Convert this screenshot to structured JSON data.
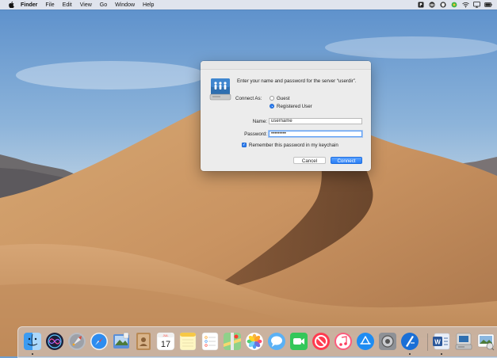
{
  "menubar": {
    "apple_icon": "apple-icon",
    "items": [
      {
        "label": "Finder",
        "name": "menu-finder"
      },
      {
        "label": "File",
        "name": "menu-file"
      },
      {
        "label": "Edit",
        "name": "menu-edit"
      },
      {
        "label": "View",
        "name": "menu-view"
      },
      {
        "label": "Go",
        "name": "menu-go"
      },
      {
        "label": "Window",
        "name": "menu-window"
      },
      {
        "label": "Help",
        "name": "menu-help"
      }
    ],
    "status_icons": [
      "parking-icon",
      "creative-cloud-icon",
      "shield-icon",
      "green-dot-icon",
      "wifi-icon",
      "airplay-icon",
      "battery-icon"
    ]
  },
  "dialog": {
    "prompt": "Enter your name and password for the server “userdir”.",
    "connect_as_label": "Connect As:",
    "options": [
      {
        "label": "Guest",
        "selected": false
      },
      {
        "label": "Registered User",
        "selected": true
      }
    ],
    "name_label": "Name:",
    "name_value": "username",
    "password_label": "Password:",
    "password_value": "•••••••••",
    "remember_label": "Remember this password in my keychain",
    "remember_checked": true,
    "cancel_label": "Cancel",
    "connect_label": "Connect"
  },
  "dock": {
    "apps": [
      "finder-icon",
      "siri-icon",
      "launchpad-icon",
      "safari-icon",
      "mail-photo-icon",
      "contacts-icon",
      "calendar-icon",
      "notes-icon",
      "reminders-icon",
      "maps-icon",
      "photos-icon",
      "messages-icon",
      "facetime-icon",
      "news-icon",
      "music-icon",
      "app-store-icon",
      "system-preferences-icon",
      "xcode-instruments-icon",
      "word-icon",
      "file-server-icon",
      "preview-icon"
    ],
    "calendar_day": "17",
    "calendar_month": "JUL",
    "word_letter": "W",
    "colors": {
      "accent": "#2f7ff2",
      "dock_bg": "#d2d2d7"
    }
  }
}
